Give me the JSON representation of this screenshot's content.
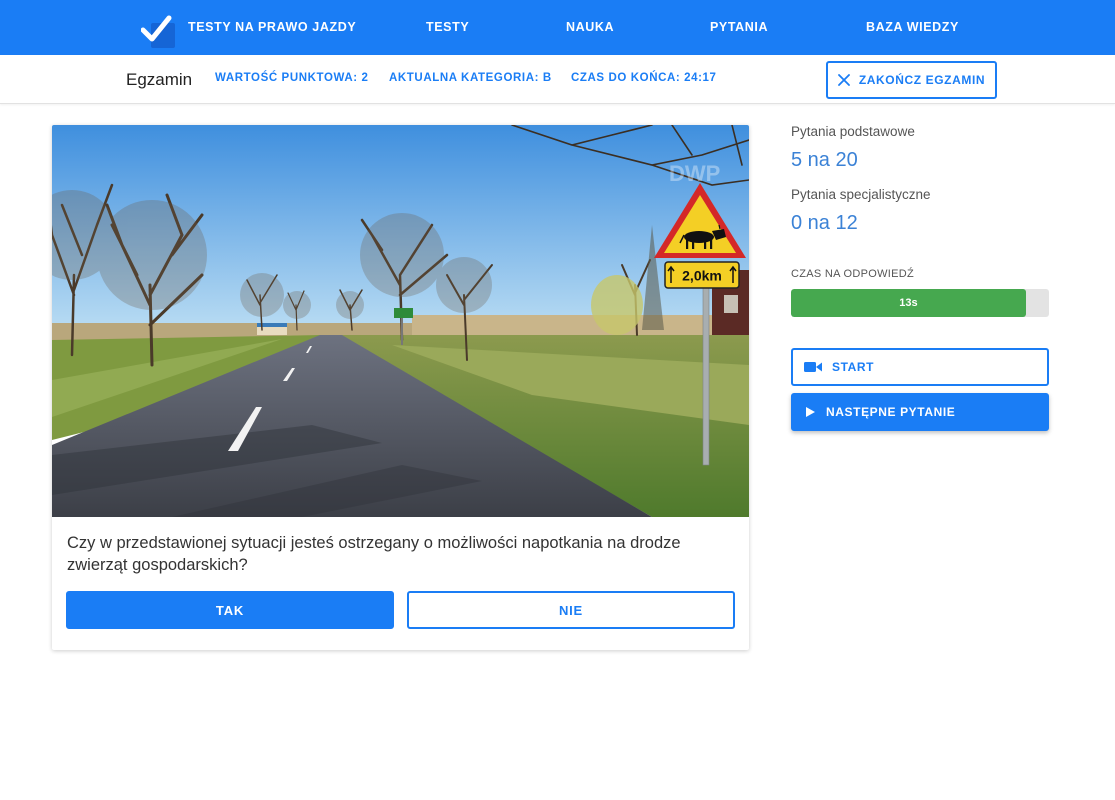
{
  "nav": {
    "brand": "TESTY NA PRAWO JAZDY",
    "items": [
      {
        "label": "TESTY"
      },
      {
        "label": "NAUKA"
      },
      {
        "label": "PYTANIA"
      },
      {
        "label": "BAZA WIEDZY"
      }
    ],
    "logo_icon": "checkmark-logo-icon"
  },
  "exam": {
    "title": "Egzamin",
    "points": "WARTOŚĆ PUNKTOWA: 2",
    "category": "AKTUALNA KATEGORIA: B",
    "time_left": "CZAS DO KOŃCA:  24:17",
    "finish_label": "ZAKOŃCZ EGZAMIN",
    "finish_icon": "close-icon"
  },
  "scene": {
    "sign_text": "2,0km",
    "watermark": "DWP",
    "sign_icon": "cow-warning-sign-icon"
  },
  "question": {
    "text": "Czy w przedstawionej sytuacji jesteś ostrzegany o możliwości napotkania na drodze zwierząt gospodarskich?",
    "yes_label": "TAK",
    "no_label": "NIE"
  },
  "side": {
    "basic_label": "Pytania podstawowe",
    "basic_value": "5 na 20",
    "special_label": "Pytania specjalistyczne",
    "special_value": "0 na 12",
    "timer_label": "CZAS NA ODPOWIEDŹ",
    "timer_value": "13s",
    "timer_fraction": 0.91,
    "start_label": "START",
    "start_icon": "video-camera-icon",
    "next_label": "NASTĘPNE PYTANIE",
    "next_icon": "play-icon"
  },
  "colors": {
    "primary": "#1a7df5",
    "progress": "#46a84f",
    "value_text": "#3b82d6"
  }
}
